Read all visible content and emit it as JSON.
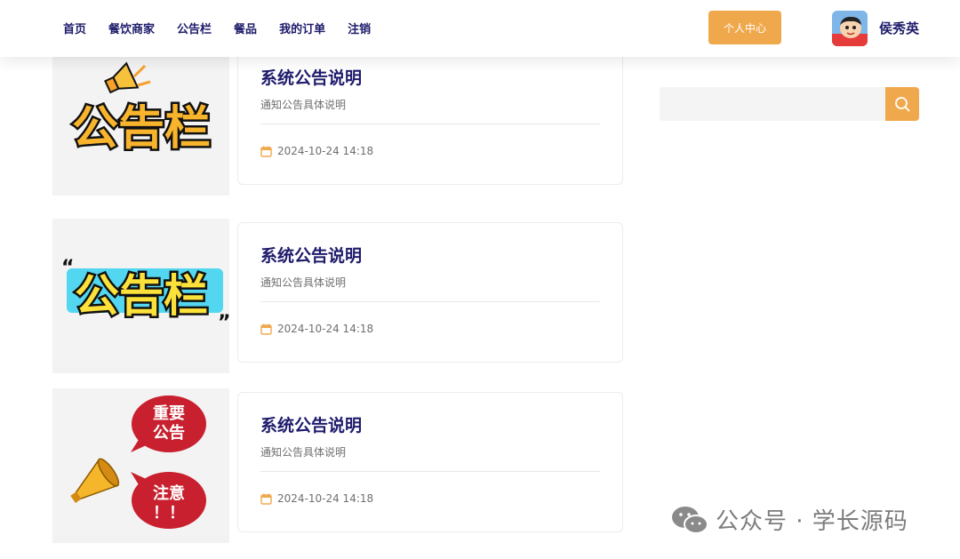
{
  "nav": {
    "items": [
      "首页",
      "餐饮商家",
      "公告栏",
      "餐品",
      "我的订单",
      "注销"
    ]
  },
  "header": {
    "personal_center": "个人中心",
    "username": "侯秀英"
  },
  "search": {
    "placeholder": ""
  },
  "notices": [
    {
      "title": "系统公告说明",
      "desc": "通知公告具体说明",
      "date": "2024-10-24 14:18",
      "badge": "公告栏"
    },
    {
      "title": "系统公告说明",
      "desc": "通知公告具体说明",
      "date": "2024-10-24 14:18",
      "badge": "公告栏"
    },
    {
      "title": "系统公告说明",
      "desc": "通知公告具体说明",
      "date": "2024-10-24 14:18",
      "badge_top": "重要\n公告",
      "badge_bottom": "注意\n！！"
    }
  ],
  "watermark": "公众号 · 学长源码",
  "colors": {
    "accent": "#f0a84d",
    "nav_text": "#1e1b6b",
    "title_text": "#1e1b6b",
    "bubble_red": "#c8202e"
  }
}
